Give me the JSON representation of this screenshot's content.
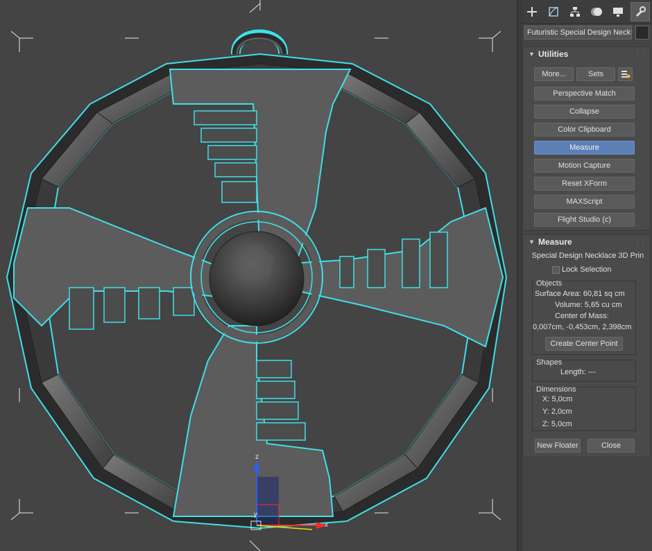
{
  "command_panel": {
    "tabs": [
      {
        "icon": "create-icon"
      },
      {
        "icon": "modify-icon"
      },
      {
        "icon": "hierarchy-icon"
      },
      {
        "icon": "motion-icon"
      },
      {
        "icon": "display-icon"
      },
      {
        "icon": "utilities-icon",
        "active": true
      }
    ],
    "object_name": "Futuristic Special Design Necklac",
    "object_color": "#2a2a2a"
  },
  "utilities": {
    "title": "Utilities",
    "more_label": "More...",
    "sets_label": "Sets",
    "config_icon": "configure-sets-icon",
    "buttons": [
      {
        "label": "Perspective Match"
      },
      {
        "label": "Collapse"
      },
      {
        "label": "Color Clipboard"
      },
      {
        "label": "Measure",
        "active": true
      },
      {
        "label": "Motion Capture"
      },
      {
        "label": "Reset XForm"
      },
      {
        "label": "MAXScript"
      },
      {
        "label": "Flight Studio (c)"
      }
    ]
  },
  "measure": {
    "title": "Measure",
    "object_name": "Special Design Necklace 3D Prin",
    "lock_selection_label": "Lock Selection",
    "lock_selection_checked": false,
    "objects": {
      "label": "Objects",
      "surface_area": "Surface Area: 60,81 sq cm",
      "volume": "Volume: 5,65 cu cm",
      "center_of_mass_label": "Center of Mass:",
      "center_of_mass_value": "0,007cm, -0,453cm, 2,398cm",
      "create_center_point_label": "Create Center Point"
    },
    "shapes": {
      "label": "Shapes",
      "length": "Length: ---"
    },
    "dimensions": {
      "label": "Dimensions",
      "x": "X:  5,0cm",
      "y": "Y:  2,0cm",
      "z": "Z:  5,0cm"
    },
    "new_floater_label": "New Floater",
    "close_label": "Close"
  },
  "viewport": {
    "background": "#444444",
    "selection_outline_color": "#3fe0e8",
    "axis_labels": {
      "x": "x",
      "y": "y",
      "z": "z"
    }
  }
}
